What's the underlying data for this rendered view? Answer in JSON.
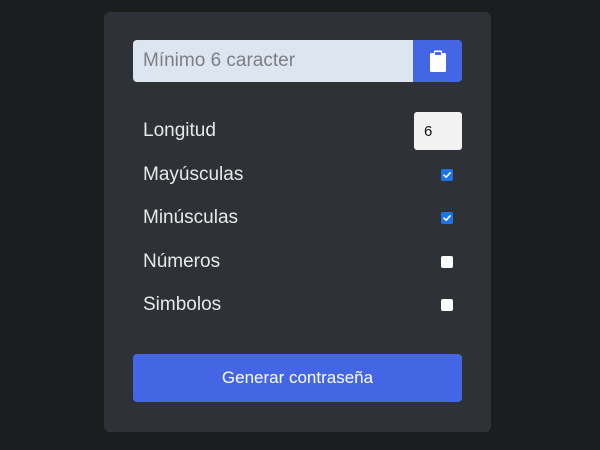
{
  "result": {
    "placeholder": "Mínimo 6 caracter",
    "value": ""
  },
  "clipboard_icon": "clipboard-icon",
  "options": {
    "length": {
      "label": "Longitud",
      "value": "6"
    },
    "uppercase": {
      "label": "Mayúsculas",
      "checked": true
    },
    "lowercase": {
      "label": "Minúsculas",
      "checked": true
    },
    "numbers": {
      "label": "Números",
      "checked": false
    },
    "symbols": {
      "label": "Simbolos",
      "checked": false
    }
  },
  "generate_label": "Generar contraseña",
  "colors": {
    "background": "#1b1d1f",
    "card": "#2e3236",
    "accent": "#4466e4",
    "checkbox_checked": "#1e73e8"
  }
}
